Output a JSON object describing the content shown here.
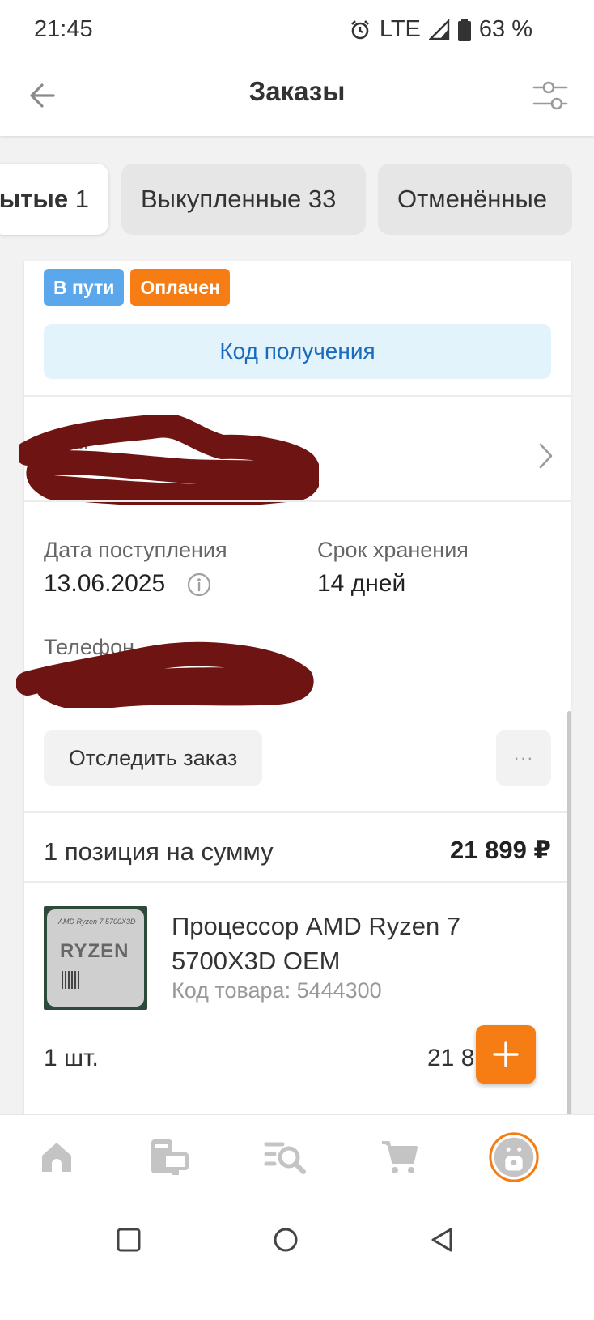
{
  "status_bar": {
    "time": "21:45",
    "network": "LTE",
    "battery": "63 %",
    "icons": [
      "alarm-icon",
      "signal-icon",
      "battery-icon"
    ]
  },
  "header": {
    "title": "Заказы",
    "back_icon": "arrow-left-icon",
    "filter_icon": "sliders-icon"
  },
  "tabs": [
    {
      "label": "ытые",
      "count": "1",
      "active": true
    },
    {
      "label": "Выкупленные 33",
      "active": false
    },
    {
      "label": "Отменённые",
      "active": false
    }
  ],
  "order": {
    "badges": [
      {
        "label": "В пути",
        "color": "#5ba7ec"
      },
      {
        "label": "Оплачен",
        "color": "#f57d14"
      }
    ],
    "code_button": "Код получения",
    "pickup_label": "Сам",
    "arrival": {
      "label": "Дата поступления",
      "value": "13.06.2025"
    },
    "storage": {
      "label": "Срок хранения",
      "value": "14 дней"
    },
    "phone_label": "Телефон",
    "track_button": "Отследить заказ",
    "more_button": "···",
    "summary": {
      "label": "1 позиция на сумму",
      "total": "21 899 ₽"
    },
    "product": {
      "title": "Процессор AMD Ryzen 7 5700X3D OEM",
      "code": "Код товара: 5444300",
      "image_brand": "AMD Ryzen 7 5700X3D",
      "image_logo": "RYZEN",
      "qty": "1 шт.",
      "price": "21 8"
    }
  },
  "bottom_nav": [
    "home-icon",
    "catalog-icon",
    "search-icon",
    "cart-icon",
    "profile-icon"
  ],
  "system_nav": [
    "recent-apps-icon",
    "home-circle-icon",
    "back-triangle-icon"
  ],
  "colors": {
    "accent": "#f57d14",
    "link": "#1a6bbd",
    "redaction": "#6e1413"
  }
}
